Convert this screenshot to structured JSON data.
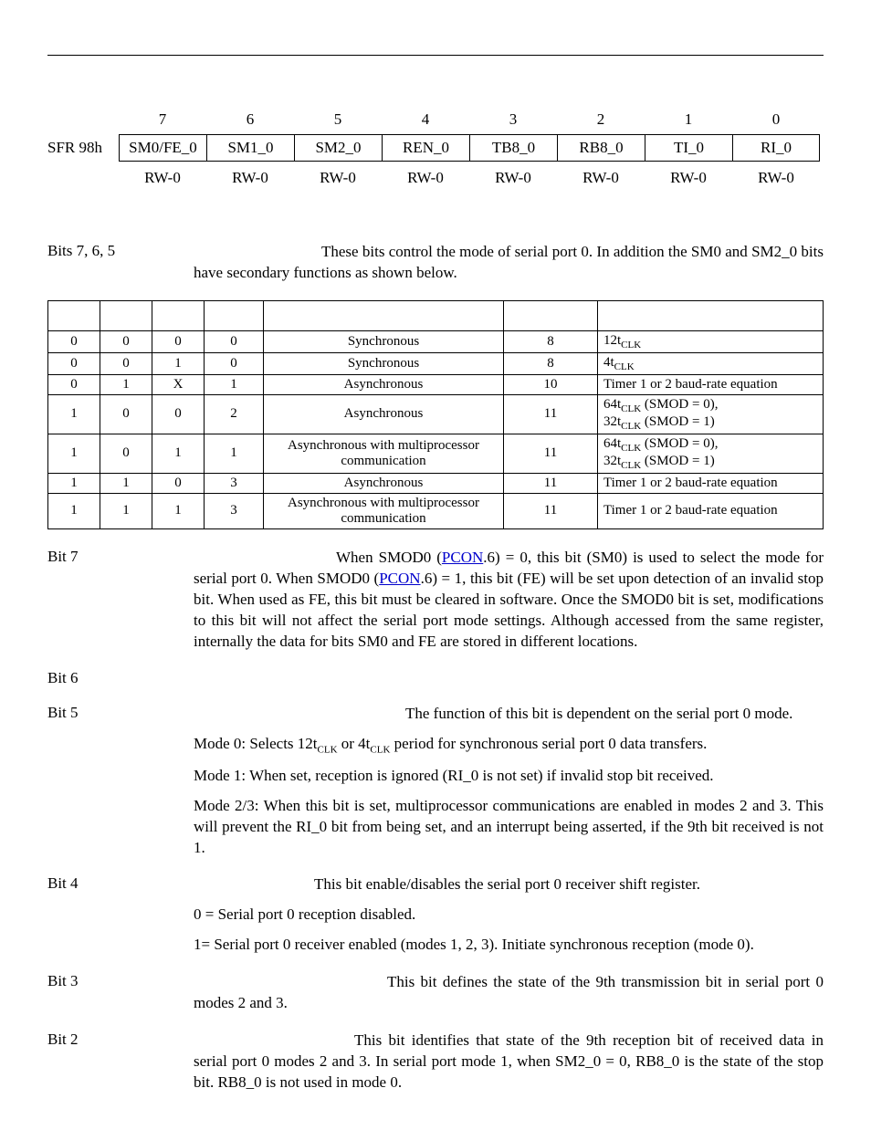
{
  "sfr": {
    "label": "SFR 98h",
    "bit_numbers": [
      "7",
      "6",
      "5",
      "4",
      "3",
      "2",
      "1",
      "0"
    ],
    "bit_names": [
      "SM0/FE_0",
      "SM1_0",
      "SM2_0",
      "REN_0",
      "TB8_0",
      "RB8_0",
      "TI_0",
      "RI_0"
    ],
    "rw": [
      "RW-0",
      "RW-0",
      "RW-0",
      "RW-0",
      "RW-0",
      "RW-0",
      "RW-0",
      "RW-0"
    ]
  },
  "bits765": {
    "label": "Bits 7, 6, 5",
    "intro": "These bits control the mode of serial port 0. In addition the SM0 and SM2_0 bits have secondary functions as shown below."
  },
  "mode_table": {
    "rows": [
      {
        "c0": "0",
        "c1": "0",
        "c2": "0",
        "c3": "0",
        "func": "Synchronous",
        "len": "8",
        "baud_html": "12t<span class='sub'>CLK</span>"
      },
      {
        "c0": "0",
        "c1": "0",
        "c2": "1",
        "c3": "0",
        "func": "Synchronous",
        "len": "8",
        "baud_html": "4t<span class='sub'>CLK</span>"
      },
      {
        "c0": "0",
        "c1": "1",
        "c2": "X",
        "c3": "1",
        "func": "Asynchronous",
        "len": "10",
        "baud_html": "Timer 1 or 2 baud-rate equation"
      },
      {
        "c0": "1",
        "c1": "0",
        "c2": "0",
        "c3": "2",
        "func": "Asynchronous",
        "len": "11",
        "baud_html": "64t<span class='sub'>CLK</span> (SMOD = 0),<br>32t<span class='sub'>CLK</span> (SMOD = 1)"
      },
      {
        "c0": "1",
        "c1": "0",
        "c2": "1",
        "c3": "1",
        "func": "Asynchronous with multiprocessor communication",
        "len": "11",
        "baud_html": "64t<span class='sub'>CLK</span> (SMOD = 0),<br>32t<span class='sub'>CLK</span> (SMOD = 1)"
      },
      {
        "c0": "1",
        "c1": "1",
        "c2": "0",
        "c3": "3",
        "func": "Asynchronous",
        "len": "11",
        "baud_html": "Timer 1 or 2 baud-rate equation"
      },
      {
        "c0": "1",
        "c1": "1",
        "c2": "1",
        "c3": "3",
        "func": "Asynchronous with multiprocessor communication",
        "len": "11",
        "baud_html": "Timer 1 or 2 baud-rate equation"
      }
    ]
  },
  "bit7": {
    "label": "Bit 7",
    "pcon": "PCON",
    "p1a": "When SMOD0 (",
    "p1b": ".6) = 0, this bit (SM0) is used to select the mode for serial port 0. When SMOD0 (",
    "p1c": ".6) = 1, this bit (FE) will be set upon detection of an invalid stop bit. When used as FE, this bit must be cleared in software. Once the SMOD0 bit is set, modifications to this bit will not affect the serial port mode settings. Although accessed from the same register, internally the data for bits SM0 and FE are stored in different locations."
  },
  "bit6": {
    "label": "Bit 6"
  },
  "bit5": {
    "label": "Bit 5",
    "p1": "The function of this bit is dependent on the serial port 0 mode.",
    "p2_html": "Mode 0: Selects 12t<span class='sub'>CLK</span> or 4t<span class='sub'>CLK</span> period for synchronous serial port 0 data transfers.",
    "p3": "Mode 1: When set, reception is ignored (RI_0 is not set) if invalid stop bit received.",
    "p4": "Mode 2/3: When this bit is set, multiprocessor communications are enabled in modes 2 and 3. This will prevent the RI_0 bit from being set, and an interrupt being asserted, if the 9th bit received is not 1."
  },
  "bit4": {
    "label": "Bit 4",
    "p1": "This bit enable/disables the serial port 0 receiver shift register.",
    "p2": "0 = Serial port 0 reception disabled.",
    "p3": "1= Serial port 0 receiver enabled (modes 1, 2, 3). Initiate synchronous reception (mode 0)."
  },
  "bit3": {
    "label": "Bit 3",
    "p1": "This bit defines the state of the 9th transmission bit in serial port 0 modes 2 and 3."
  },
  "bit2": {
    "label": "Bit 2",
    "p1": "This bit identifies that state of the 9th reception bit of received data in serial port 0 modes 2 and 3. In serial port mode 1, when SM2_0 = 0, RB8_0 is the state of the stop bit. RB8_0 is not used in mode 0."
  }
}
